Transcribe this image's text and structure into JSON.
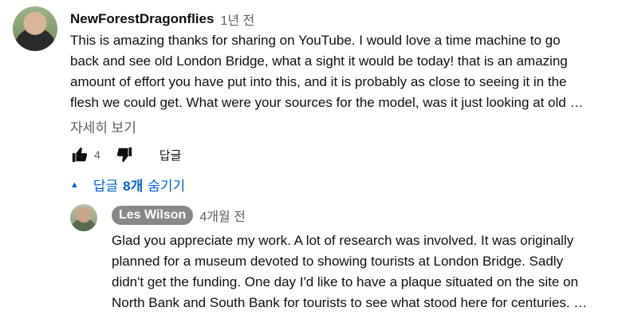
{
  "comment": {
    "author": "NewForestDragonflies",
    "time": "1년 전",
    "lines": [
      "This is amazing thanks for sharing on YouTube. I would love a time machine to go",
      "back and see old London Bridge, what a sight it would be today! that is an amazing",
      "amount of effort you have put into this, and it is probably as close to seeing it in the",
      "flesh we could get. What were your sources for the model, was it just looking at old …"
    ],
    "more_label": "자세히 보기",
    "likes": "4",
    "reply_label": "답글"
  },
  "replies_toggle": {
    "prefix": "답글",
    "count": "8개",
    "suffix": "숨기기",
    "color": "#065fd4"
  },
  "reply": {
    "author": "Les Wilson",
    "time": "4개월 전",
    "lines": [
      "Glad you appreciate my work. A lot of research was involved. It was originally",
      "planned for a museum devoted to showing tourists at London Bridge. Sadly",
      "didn't get the funding. One day I'd like to have a plaque situated on the site on",
      "North Bank and South Bank for tourists to see what stood here for centuries. …"
    ]
  },
  "icons": {
    "like": "thumbs-up-icon",
    "dislike": "thumbs-down-icon",
    "toggle": "caret-up-icon"
  }
}
